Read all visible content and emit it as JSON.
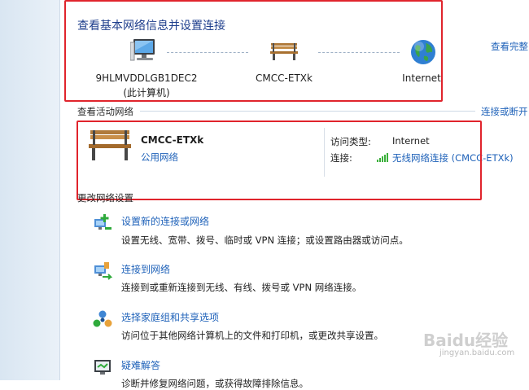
{
  "header": {
    "title": "查看基本网络信息并设置连接",
    "view_full_map": "查看完整"
  },
  "map": {
    "computer_name": "9HLMVDDLGB1DEC2",
    "computer_sub": "(此计算机)",
    "network_name": "CMCC-ETXk",
    "internet": "Internet"
  },
  "active": {
    "section_label": "查看活动网络",
    "connect_disconnect": "连接或断开",
    "network_name": "CMCC-ETXk",
    "network_type": "公用网络",
    "access_type_label": "访问类型:",
    "access_type_value": "Internet",
    "connection_label": "连接:",
    "connection_value": "无线网络连接 (CMCC-ETXk)"
  },
  "change": {
    "section_label": "更改网络设置",
    "tasks": [
      {
        "title": "设置新的连接或网络",
        "desc": "设置无线、宽带、拨号、临时或 VPN 连接；或设置路由器或访问点。",
        "icon": "new-connection-icon"
      },
      {
        "title": "连接到网络",
        "desc": "连接到或重新连接到无线、有线、拨号或 VPN 网络连接。",
        "icon": "connect-network-icon"
      },
      {
        "title": "选择家庭组和共享选项",
        "desc": "访问位于其他网络计算机上的文件和打印机，或更改共享设置。",
        "icon": "homegroup-icon"
      },
      {
        "title": "疑难解答",
        "desc": "诊断并修复网络问题，或获得故障排除信息。",
        "icon": "troubleshoot-icon"
      }
    ]
  },
  "watermark": {
    "text": "Baidu经验",
    "sub": "jingyan.baidu.com"
  },
  "colors": {
    "link": "#1f62b9",
    "title": "#1e3e8c",
    "highlight": "#e0242c"
  }
}
